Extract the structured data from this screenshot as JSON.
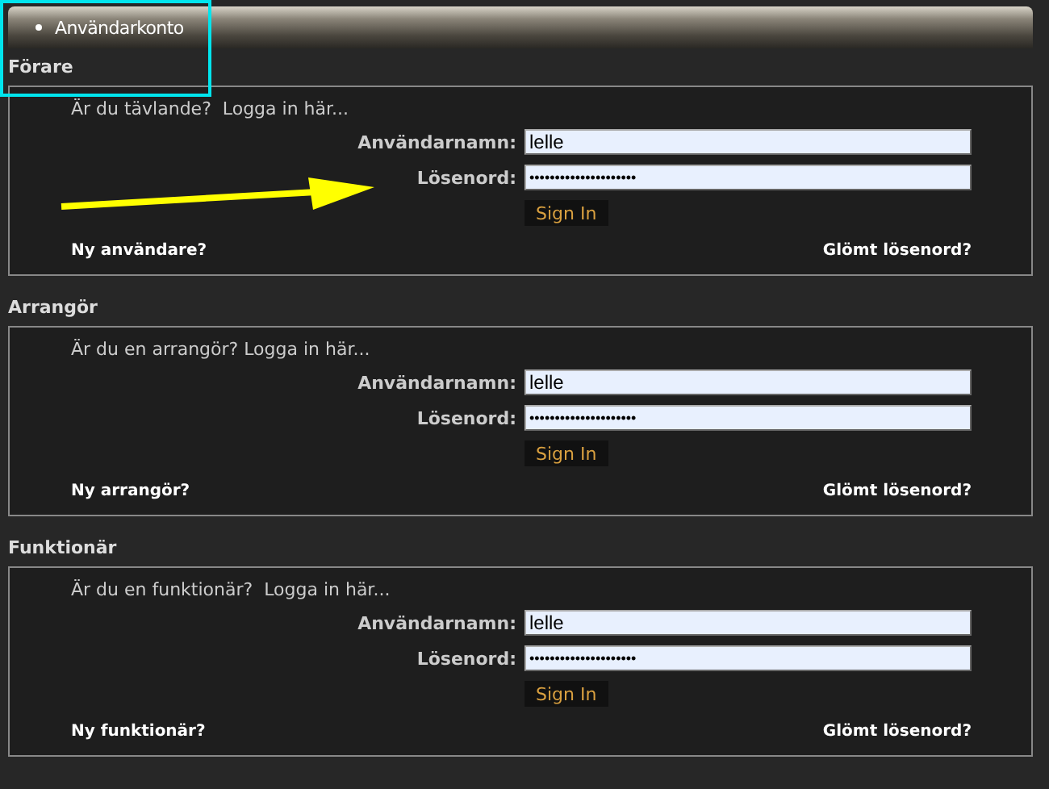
{
  "menu_bar": {
    "items": [
      "Användarkonto"
    ]
  },
  "sections": [
    {
      "heading": "Förare",
      "prompt": "Är du tävlande?  Logga in här...",
      "username_label": "Användarnamn:",
      "username_value": "lelle",
      "password_label": "Lösenord:",
      "password_value": "•••••••••••••••••••••",
      "button": "Sign In",
      "new_link": "Ny användare?",
      "forgot_link": "Glömt lösenord?"
    },
    {
      "heading": "Arrangör",
      "prompt": "Är du en arrangör? Logga in här...",
      "username_label": "Användarnamn:",
      "username_value": "lelle",
      "password_label": "Lösenord:",
      "password_value": "•••••••••••••••••••••",
      "button": "Sign In",
      "new_link": "Ny arrangör?",
      "forgot_link": "Glömt lösenord?"
    },
    {
      "heading": "Funktionär",
      "prompt": "Är du en funktionär?  Logga in här...",
      "username_label": "Användarnamn:",
      "username_value": "lelle",
      "password_label": "Lösenord:",
      "password_value": "•••••••••••••••••••••",
      "button": "Sign In",
      "new_link": "Ny funktionär?",
      "forgot_link": "Glömt lösenord?"
    }
  ]
}
